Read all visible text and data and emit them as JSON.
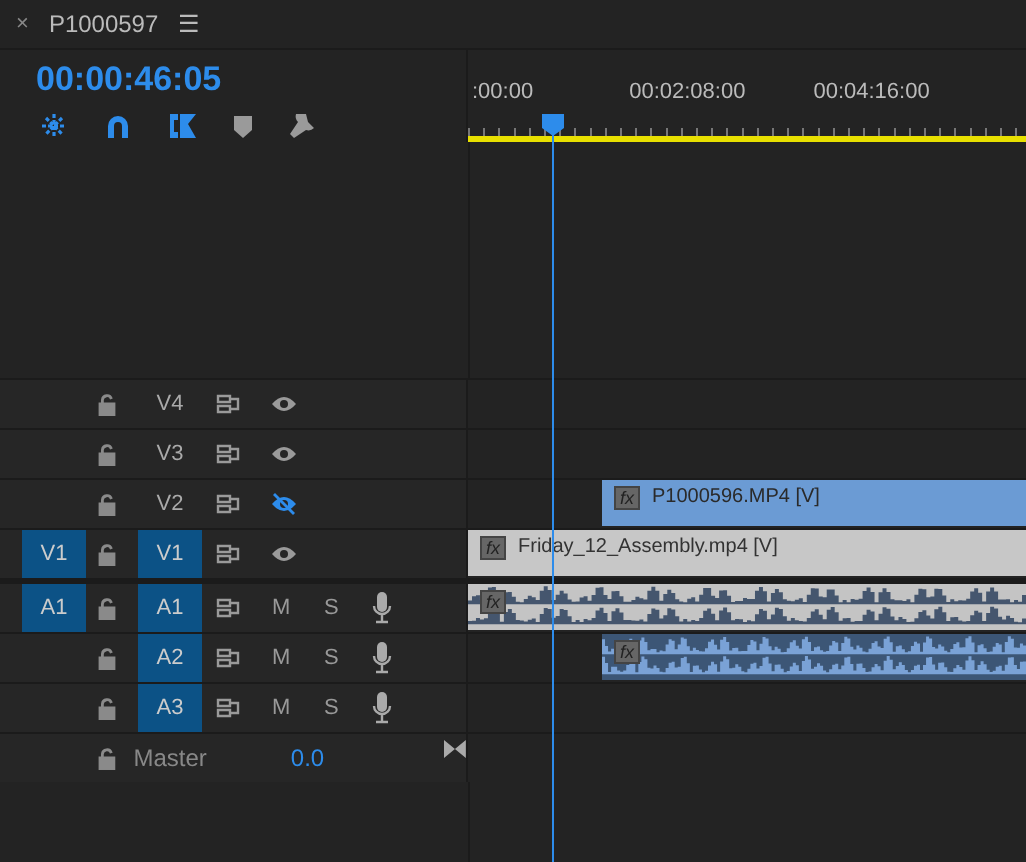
{
  "panel": {
    "close": "×",
    "title": "P1000597",
    "menu": "☰"
  },
  "timecode": "00:00:46:05",
  "tools": [
    {
      "kind": "insert",
      "on": true
    },
    {
      "kind": "snap",
      "on": true
    },
    {
      "kind": "linked",
      "on": true
    },
    {
      "kind": "marker",
      "on": false
    },
    {
      "kind": "settings",
      "on": false
    }
  ],
  "ruler": {
    "labels": [
      ":00:00",
      "00:02:08:00",
      "00:04:16:00"
    ]
  },
  "tracks": [
    {
      "kind": "video",
      "label": "V4",
      "targeted": false,
      "visible": true
    },
    {
      "kind": "video",
      "label": "V3",
      "targeted": false,
      "visible": true
    },
    {
      "kind": "video",
      "label": "V2",
      "targeted": false,
      "visible": false,
      "clip": {
        "name": "P1000596.MP4 [V]",
        "fx": "fx",
        "offset": true,
        "selected": false
      }
    },
    {
      "kind": "video",
      "label": "V1",
      "source": "V1",
      "targeted": true,
      "visible": true,
      "clip": {
        "name": "Friday_12_Assembly.mp4 [V]",
        "fx": "fx",
        "offset": false,
        "selected": true
      }
    },
    {
      "kind": "audio",
      "label": "A1",
      "source": "A1",
      "targeted": true,
      "mute": "M",
      "solo": "S",
      "clip": {
        "fx": "fx",
        "offset": false,
        "selected": true
      }
    },
    {
      "kind": "audio",
      "label": "A2",
      "targeted": true,
      "mute": "M",
      "solo": "S",
      "clip": {
        "fx": "fx",
        "offset": true,
        "selected": false
      }
    },
    {
      "kind": "audio",
      "label": "A3",
      "targeted": true,
      "mute": "M",
      "solo": "S"
    },
    {
      "kind": "master",
      "label": "Master",
      "value": "0.0"
    }
  ]
}
